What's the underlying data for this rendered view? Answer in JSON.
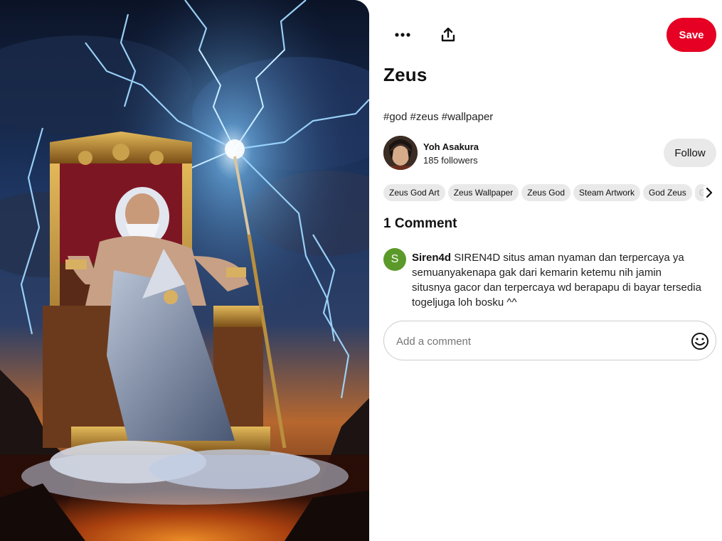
{
  "pin": {
    "title": "Zeus",
    "description": "#god #zeus #wallpaper"
  },
  "toolbar": {
    "more_icon": "ellipsis-icon",
    "share_icon": "share-icon",
    "save_label": "Save"
  },
  "creator": {
    "name": "Yoh Asakura",
    "followers": "185 followers",
    "follow_label": "Follow"
  },
  "tags": [
    "Zeus God Art",
    "Zeus Wallpaper",
    "Zeus God",
    "Steam Artwork",
    "God Zeus",
    "G"
  ],
  "comments": {
    "count_label": "1 Comment",
    "items": [
      {
        "avatar_letter": "S",
        "author": "Siren4d",
        "text": "SIREN4D situs aman nyaman dan terpercaya ya semuanyakenapa gak dari kemarin ketemu nih jamin situsnya gacor dan terpercaya wd berapapu di bayar tersedia togeljuga loh bosku ^^"
      }
    ],
    "input_placeholder": "Add a comment"
  },
  "colors": {
    "save": "#e60023",
    "follow_bg": "#e9e9e9",
    "tag_bg": "#e9e9e9",
    "comment_avatar": "#5b9a2a"
  }
}
